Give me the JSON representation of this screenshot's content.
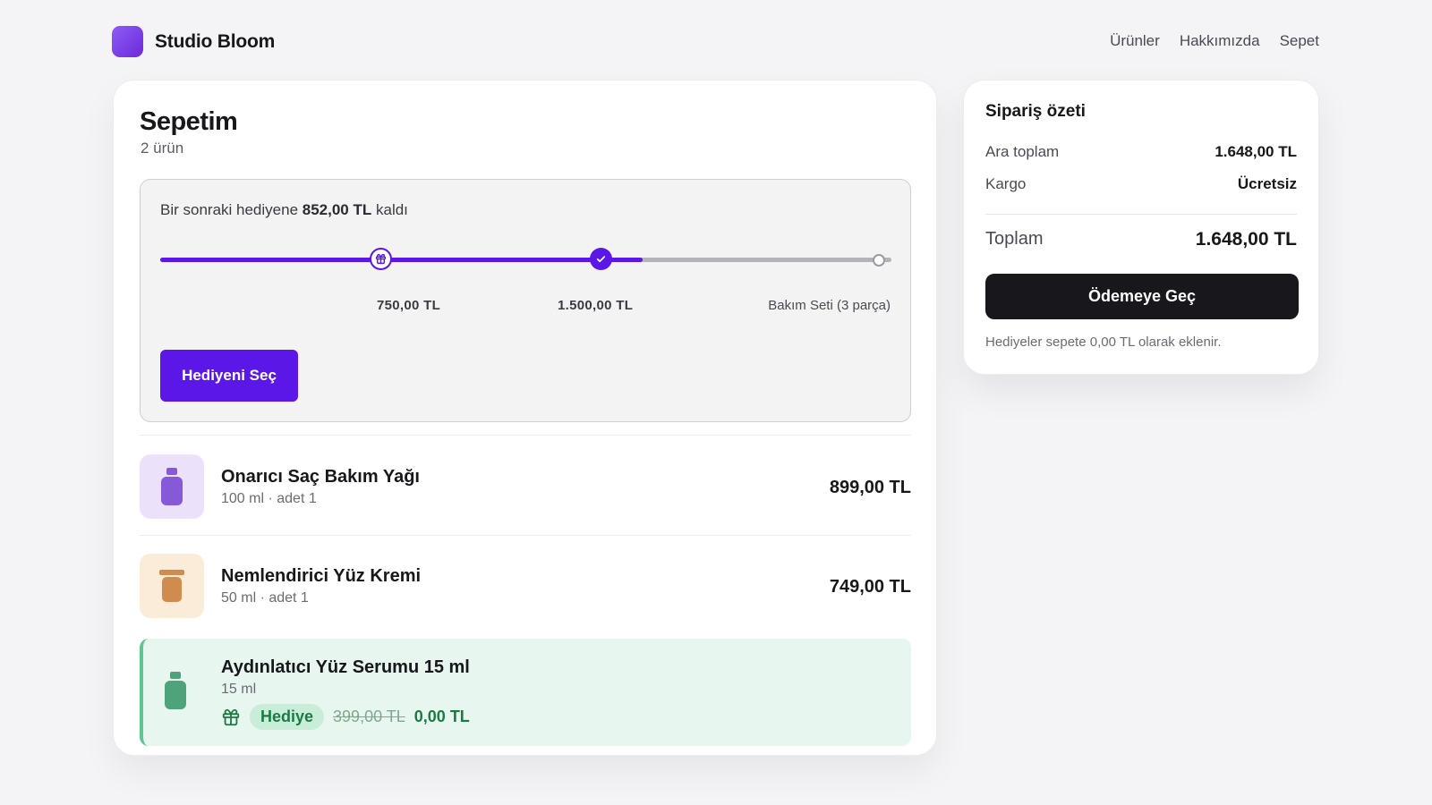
{
  "brand": {
    "name": "Studio Bloom",
    "accent": "#7c3aed"
  },
  "nav": {
    "items": [
      "Ürünler",
      "Hakkımızda",
      "Sepet"
    ]
  },
  "cart": {
    "title": "Sepetim",
    "count_label": "2 ürün",
    "gift_progress": {
      "message_prefix": "Bir sonraki hediyene",
      "remaining": "852,00 TL",
      "message_suffix": "kaldı",
      "progress_fraction": 0.66,
      "milestones": [
        {
          "label": "750,00 TL",
          "icon": "gift-icon",
          "state": "reached"
        },
        {
          "label": "1.500,00 TL",
          "icon": "check-icon",
          "state": "reached"
        },
        {
          "label": "Bakım Seti (3 parça)",
          "state": "upcoming"
        }
      ],
      "button_label": "Hediyeni Seç",
      "accent": "#5b16e8"
    },
    "items": [
      {
        "name": "Onarıcı Saç Bakım Yağı",
        "meta": "100 ml · adet 1",
        "price": "899,00 TL",
        "icon": "bottle-icon",
        "thumb_bg": "#ebe1fb",
        "icon_color": "#8659d8"
      },
      {
        "name": "Nemlendirici Yüz Kremi",
        "meta": "50 ml · adet 1",
        "price": "749,00 TL",
        "icon": "jar-icon",
        "thumb_bg": "#fbecd9",
        "icon_color": "#d08c4e"
      }
    ],
    "gift_item": {
      "name": "Aydınlatıcı Yüz Serumu 15 ml",
      "meta": "15 ml",
      "badge": "Hediye",
      "old_price": "399,00 TL",
      "new_price": "0,00 TL",
      "icon": "bottle-icon",
      "icon_color": "#4ea37a"
    }
  },
  "summary": {
    "title": "Sipariş özeti",
    "subtotal_label": "Ara toplam",
    "subtotal_value": "1.648,00 TL",
    "shipping_label": "Kargo",
    "shipping_value": "Ücretsiz",
    "total_label": "Toplam",
    "total_value": "1.648,00 TL",
    "checkout_label": "Ödemeye Geç",
    "note": "Hediyeler sepete 0,00 TL olarak eklenir."
  }
}
